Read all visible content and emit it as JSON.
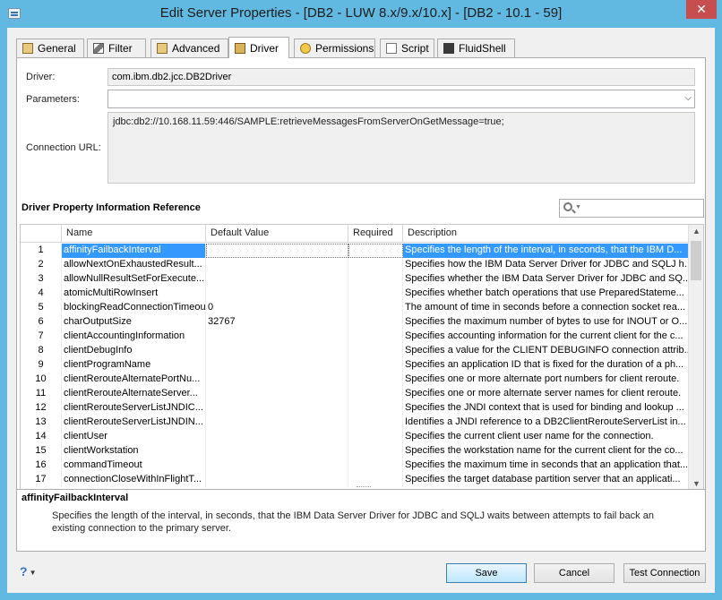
{
  "window": {
    "title": "Edit Server Properties - [DB2 - LUW 8.x/9.x/10.x] - [DB2 - 10.1 - 59]",
    "close_label": "✕"
  },
  "tabs": [
    {
      "label": "General",
      "icon": "general-icon",
      "active": false
    },
    {
      "label": "Filter",
      "icon": "filter-icon",
      "active": false
    },
    {
      "label": "Advanced",
      "icon": "advanced-icon",
      "active": false
    },
    {
      "label": "Driver",
      "icon": "driver-icon",
      "active": true
    },
    {
      "label": "Permissions",
      "icon": "permissions-icon",
      "active": false
    },
    {
      "label": "Script",
      "icon": "script-icon",
      "active": false
    },
    {
      "label": "FluidShell",
      "icon": "fluidshell-icon",
      "active": false
    }
  ],
  "form": {
    "driver_label": "Driver:",
    "driver_value": "com.ibm.db2.jcc.DB2Driver",
    "parameters_label": "Parameters:",
    "parameters_value": "",
    "url_label": "Connection URL:",
    "url_value": "jdbc:db2://10.168.11.59:446/SAMPLE:retrieveMessagesFromServerOnGetMessage=true;"
  },
  "reference": {
    "title": "Driver Property Information Reference",
    "search_value": ""
  },
  "table": {
    "columns": [
      "Name",
      "Default Value",
      "Required",
      "Description"
    ],
    "rows": [
      {
        "num": "1",
        "name": "affinityFailbackInterval",
        "default": "",
        "required": "",
        "description": "Specifies the length of the interval, in seconds, that the IBM D..."
      },
      {
        "num": "2",
        "name": "allowNextOnExhaustedResult...",
        "default": "",
        "required": "",
        "description": "Specifies how the IBM Data Server Driver for JDBC and SQLJ h..."
      },
      {
        "num": "3",
        "name": "allowNullResultSetForExecute...",
        "default": "",
        "required": "",
        "description": "Specifies whether the IBM Data Server Driver for JDBC and SQ..."
      },
      {
        "num": "4",
        "name": "atomicMultiRowInsert",
        "default": "",
        "required": "",
        "description": "Specifies whether batch operations that use PreparedStateme..."
      },
      {
        "num": "5",
        "name": "blockingReadConnectionTimeout",
        "default": "0",
        "required": "",
        "description": "The amount of time in seconds before a connection socket rea..."
      },
      {
        "num": "6",
        "name": "charOutputSize",
        "default": "32767",
        "required": "",
        "description": "Specifies the maximum number of bytes to use for INOUT or O..."
      },
      {
        "num": "7",
        "name": "clientAccountingInformation",
        "default": "",
        "required": "",
        "description": "Specifies accounting information for the current client for the c..."
      },
      {
        "num": "8",
        "name": "clientDebugInfo",
        "default": "",
        "required": "",
        "description": "Specifies a value for the CLIENT DEBUGINFO connection attrib..."
      },
      {
        "num": "9",
        "name": "clientProgramName",
        "default": "",
        "required": "",
        "description": "Specifies an application ID that is fixed for the duration of a ph..."
      },
      {
        "num": "10",
        "name": "clientRerouteAlternatePortNu...",
        "default": "",
        "required": "",
        "description": "Specifies one or more alternate port numbers for client reroute."
      },
      {
        "num": "11",
        "name": "clientRerouteAlternateServer...",
        "default": "",
        "required": "",
        "description": "Specifies one or more alternate server names for client reroute."
      },
      {
        "num": "12",
        "name": "clientRerouteServerListJNDIC...",
        "default": "",
        "required": "",
        "description": "Specifies the JNDI context that is used for binding and lookup ..."
      },
      {
        "num": "13",
        "name": "clientRerouteServerListJNDIN...",
        "default": "",
        "required": "",
        "description": "Identifies a JNDI reference to a DB2ClientRerouteServerList in..."
      },
      {
        "num": "14",
        "name": "clientUser",
        "default": "",
        "required": "",
        "description": "Specifies the current client user name for the connection."
      },
      {
        "num": "15",
        "name": "clientWorkstation",
        "default": "",
        "required": "",
        "description": "Specifies the workstation name for the current client for the co..."
      },
      {
        "num": "16",
        "name": "commandTimeout",
        "default": "",
        "required": "",
        "description": "Specifies the maximum time in seconds that an application that..."
      },
      {
        "num": "17",
        "name": "connectionCloseWithInFlightT...",
        "default": "",
        "required": "",
        "description": "Specifies the target database partition server that an applicati..."
      }
    ]
  },
  "detail": {
    "title": "affinityFailbackInterval",
    "text": "Specifies the length of the interval, in seconds, that the IBM Data Server Driver for JDBC and SQLJ waits between attempts to fail back an existing connection to the primary server."
  },
  "buttons": {
    "help": "?",
    "save": "Save",
    "cancel": "Cancel",
    "test": "Test Connection"
  },
  "colors": {
    "title_bar": "#61b9e2",
    "selection": "#3399ff",
    "close": "#c74e4e"
  }
}
